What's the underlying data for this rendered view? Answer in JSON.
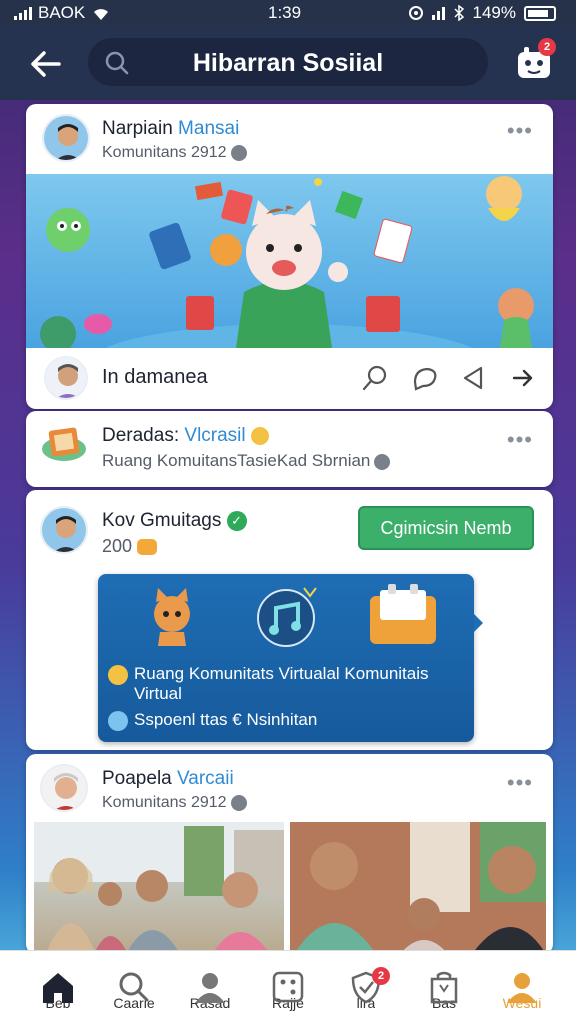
{
  "status_bar": {
    "carrier": "BAOK",
    "time": "1:39",
    "battery": "149%"
  },
  "header": {
    "title": "Hibarran Sosiial",
    "notification_count": "2"
  },
  "posts": [
    {
      "author": "Narpiain",
      "tag": "Mansai",
      "subtitle": "Komunitans 2912",
      "reply_label": "In damanea"
    },
    {
      "author": "Deradas:",
      "tag": "Vlcrasil",
      "subtitle": "Ruang KomuitansTasieKad Sbrnian"
    },
    {
      "author": "Kov Gmuitags",
      "subtitle": "200",
      "follow_label": "Cgimicsin Nemb",
      "promo": {
        "line1": "Ruang Komunitats Virtualal Komunitais Virtual",
        "line2": "Sspoenl ttas € Nsinhitan"
      }
    },
    {
      "author": "Poapela",
      "tag": "Varcaii",
      "subtitle": "Komunitans 2912"
    }
  ],
  "bottom_nav": {
    "badge": "2",
    "items": [
      {
        "label": "Beb",
        "icon": "home-icon"
      },
      {
        "label": "Caarie",
        "icon": "search-icon"
      },
      {
        "label": "Rasad",
        "icon": "profile-icon"
      },
      {
        "label": "Rajje",
        "icon": "dice-icon"
      },
      {
        "label": "lira",
        "icon": "shield-icon"
      },
      {
        "label": "Bas",
        "icon": "bag-icon"
      },
      {
        "label": "Wesui",
        "icon": "user-icon"
      }
    ],
    "active_color": "#e8a13a"
  },
  "colors": {
    "accent": "#2f8bd3",
    "follow": "#3cb06a",
    "header": "#263350"
  }
}
